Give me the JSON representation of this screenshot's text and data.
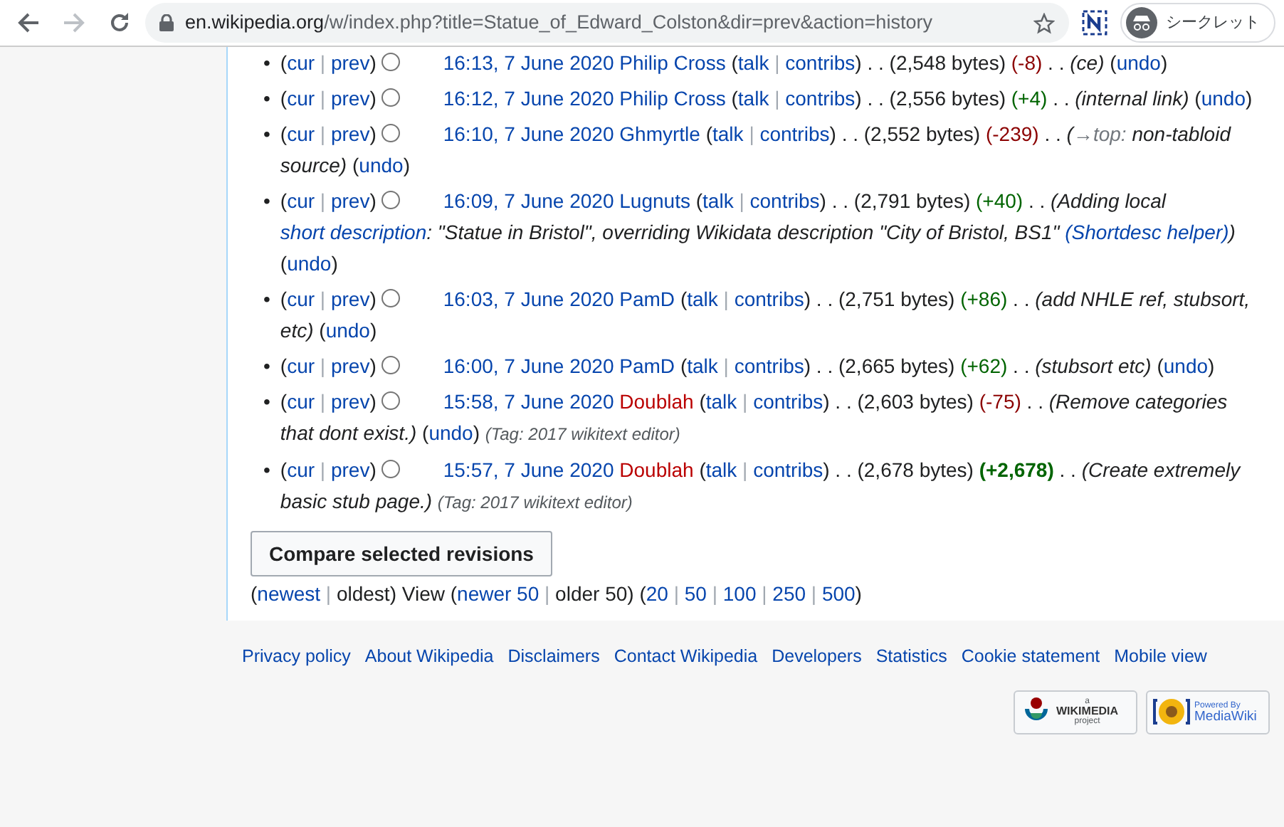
{
  "browser": {
    "url_host": "en.wikipedia.org",
    "url_path": "/w/index.php?title=Statue_of_Edward_Colston&dir=prev&action=history",
    "forward_disabled": true,
    "profile_label": "シークレット"
  },
  "separators": {
    "open": "(",
    "close": ")",
    "pipe": "|",
    "dots": ". ."
  },
  "history": {
    "revisions": [
      {
        "bullet": "•",
        "cur": "cur",
        "prev": "prev",
        "selected": false,
        "time": "16:13, 7 June 2020",
        "user": "Philip Cross",
        "user_page_missing": false,
        "talk": "talk",
        "contribs": "contribs",
        "bytes": "(2,548 bytes)",
        "diff": "(-8)",
        "decrease": true,
        "large": false,
        "summary": [
          {
            "kind": "text",
            "text": "(ce)"
          }
        ],
        "undo": "undo"
      },
      {
        "bullet": "•",
        "cur": "cur",
        "prev": "prev",
        "selected": false,
        "time": "16:12, 7 June 2020",
        "user": "Philip Cross",
        "user_page_missing": false,
        "talk": "talk",
        "contribs": "contribs",
        "bytes": "(2,556 bytes)",
        "diff": "(+4)",
        "decrease": false,
        "large": false,
        "summary": [
          {
            "kind": "text",
            "text": "(internal link)"
          }
        ],
        "undo": "undo"
      },
      {
        "bullet": "•",
        "cur": "cur",
        "prev": "prev",
        "selected": false,
        "time": "16:10, 7 June 2020",
        "user": "Ghmyrtle",
        "user_page_missing": false,
        "talk": "talk",
        "contribs": "contribs",
        "bytes": "(2,552 bytes)",
        "diff": "(-239)",
        "decrease": true,
        "large": false,
        "summary": [
          {
            "kind": "text",
            "text": "("
          },
          {
            "kind": "section",
            "text": "→top:"
          },
          {
            "kind": "text",
            "text": " non-tabloid source)"
          }
        ],
        "undo": "undo"
      },
      {
        "bullet": "•",
        "cur": "cur",
        "prev": "prev",
        "selected": false,
        "time": "16:09, 7 June 2020",
        "user": "Lugnuts",
        "user_page_missing": false,
        "talk": "talk",
        "contribs": "contribs",
        "bytes": "(2,791 bytes)",
        "diff": "(+40)",
        "decrease": false,
        "large": false,
        "summary": [
          {
            "kind": "text",
            "text": "(Adding local "
          },
          {
            "kind": "link",
            "text": "short description"
          },
          {
            "kind": "text",
            "text": ": \"Statue in Bristol\", overriding Wikidata description \"City of Bristol, BS1\" "
          },
          {
            "kind": "link",
            "text": "(Shortdesc helper)"
          },
          {
            "kind": "text",
            "text": ")"
          }
        ],
        "undo": "undo"
      },
      {
        "bullet": "•",
        "cur": "cur",
        "prev": "prev",
        "selected": false,
        "time": "16:03, 7 June 2020",
        "user": "PamD",
        "user_page_missing": false,
        "talk": "talk",
        "contribs": "contribs",
        "bytes": "(2,751 bytes)",
        "diff": "(+86)",
        "decrease": false,
        "large": false,
        "summary": [
          {
            "kind": "text",
            "text": "(add NHLE ref, stubsort, etc)"
          }
        ],
        "undo": "undo"
      },
      {
        "bullet": "•",
        "cur": "cur",
        "prev": "prev",
        "selected": false,
        "time": "16:00, 7 June 2020",
        "user": "PamD",
        "user_page_missing": false,
        "talk": "talk",
        "contribs": "contribs",
        "bytes": "(2,665 bytes)",
        "diff": "(+62)",
        "decrease": false,
        "large": false,
        "summary": [
          {
            "kind": "text",
            "text": "(stubsort etc)"
          }
        ],
        "undo": "undo"
      },
      {
        "bullet": "•",
        "cur": "cur",
        "prev": "prev",
        "selected": false,
        "time": "15:58, 7 June 2020",
        "user": "Doublah",
        "user_page_missing": true,
        "talk": "talk",
        "contribs": "contribs",
        "bytes": "(2,603 bytes)",
        "diff": "(-75)",
        "decrease": true,
        "large": false,
        "summary": [
          {
            "kind": "text",
            "text": "(Remove categories that dont exist.)"
          }
        ],
        "undo": "undo",
        "tag": "(Tag: 2017 wikitext editor)"
      },
      {
        "bullet": "•",
        "cur": "cur",
        "prev": "prev",
        "selected": false,
        "time": "15:57, 7 June 2020",
        "user": "Doublah",
        "user_page_missing": true,
        "talk": "talk",
        "contribs": "contribs",
        "bytes": "(2,678 bytes)",
        "diff": "(+2,678)",
        "decrease": false,
        "large": true,
        "summary": [
          {
            "kind": "text",
            "text": "(Create extremely basic stub page.)"
          }
        ],
        "tag": "(Tag: 2017 wikitext editor)"
      }
    ],
    "compare_button": "Compare selected revisions",
    "nav_first": [
      {
        "text": "newest",
        "disabled": false
      },
      {
        "text": "oldest",
        "disabled": true
      }
    ],
    "view_label": "View",
    "nav_paging": [
      {
        "text": "newer 50",
        "disabled": false
      },
      {
        "text": "older 50",
        "disabled": true
      }
    ],
    "limits": [
      {
        "text": "20",
        "disabled": false
      },
      {
        "text": "50",
        "disabled": false
      },
      {
        "text": "100",
        "disabled": false
      },
      {
        "text": "250",
        "disabled": false
      },
      {
        "text": "500",
        "disabled": false
      }
    ]
  },
  "footer": {
    "links": [
      "Privacy policy",
      "About Wikipedia",
      "Disclaimers",
      "Contact Wikipedia",
      "Developers",
      "Statistics",
      "Cookie statement",
      "Mobile view"
    ],
    "badges": [
      {
        "kind": "wikimedia",
        "top": "a",
        "name": "WIKIMEDIA",
        "bottom": "project"
      },
      {
        "kind": "mediawiki",
        "top": "Powered By",
        "name": "MediaWiki"
      }
    ]
  }
}
